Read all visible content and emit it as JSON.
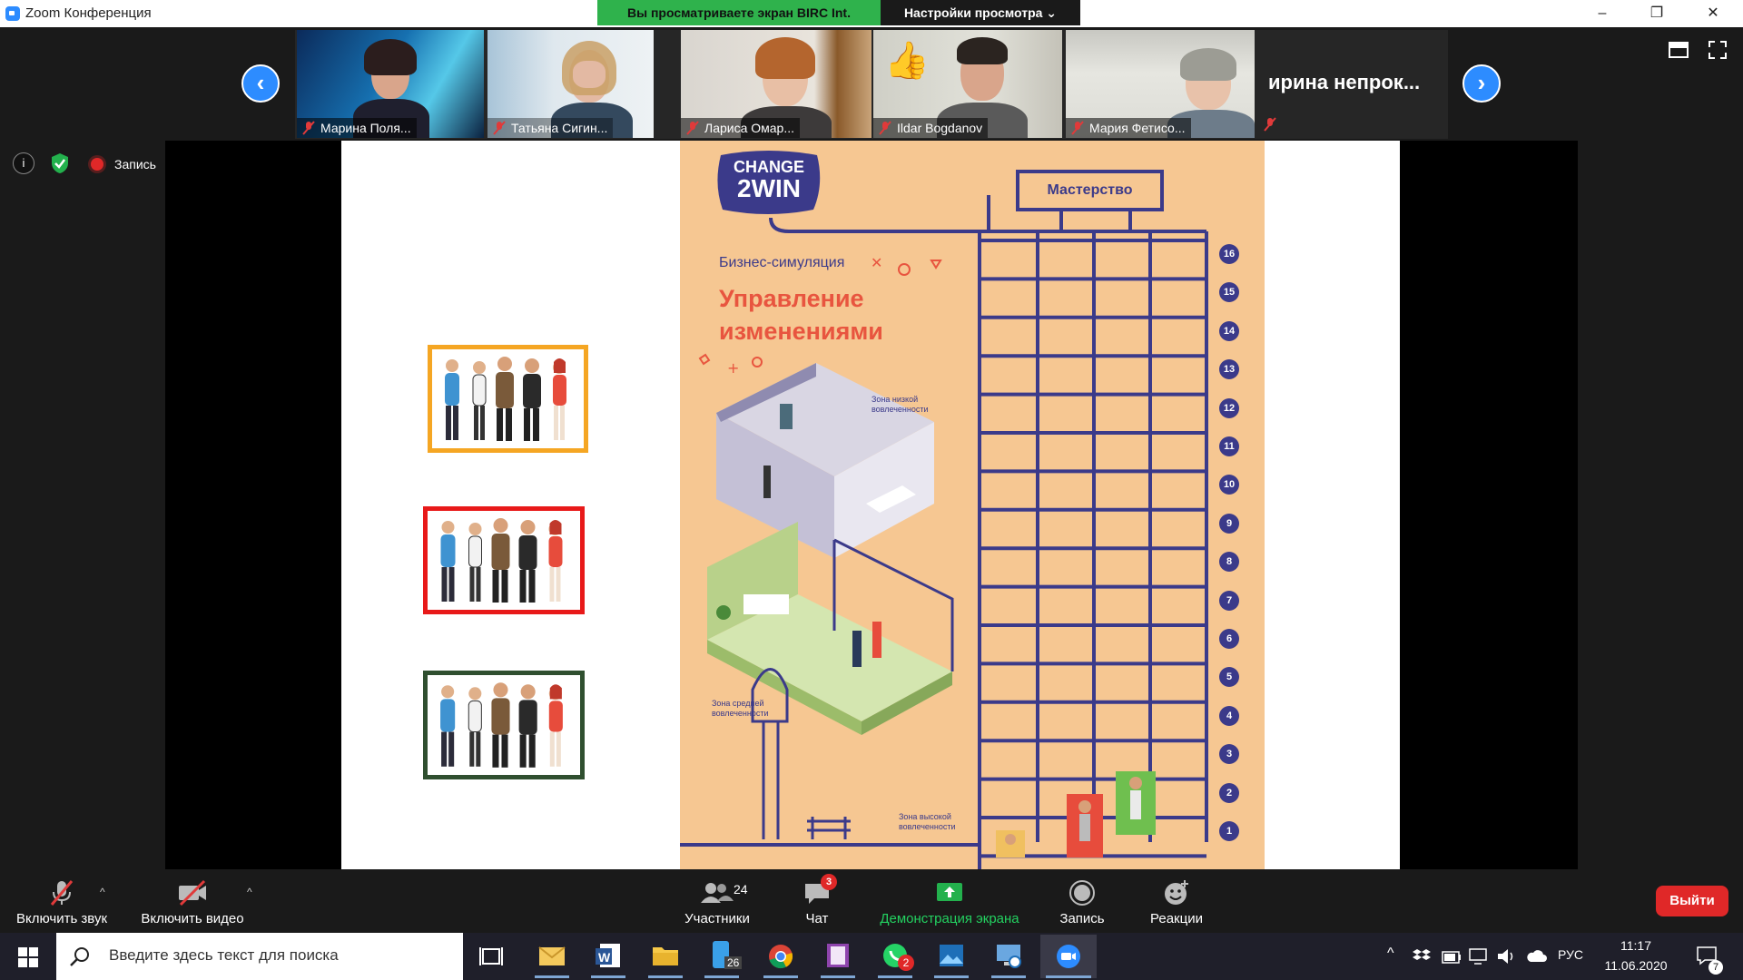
{
  "window": {
    "title": "Zoom Конференция",
    "minimize": "–",
    "restore": "❐",
    "close": "✕"
  },
  "share_banner": {
    "text": "Вы просматриваете экран BIRC Int.",
    "view_options": "Настройки просмотра ⌄"
  },
  "participants": [
    {
      "name": "Марина Поля..."
    },
    {
      "name": "Татьяна Сигин..."
    },
    {
      "name": "Лариса Омар..."
    },
    {
      "name": "Ildar Bogdanov"
    },
    {
      "name": "Мария Фетисо..."
    },
    {
      "name": "ирина  непрок..."
    }
  ],
  "meeting_info": {
    "recording_label": "Запись"
  },
  "slide": {
    "brand_line1": "CHANGE",
    "brand_line2": "2WIN",
    "mastery": "Мастерство",
    "subtitle": "Бизнес-симуляция",
    "title_line1": "Управление",
    "title_line2": "изменениями",
    "zone_low": "Зона низкой вовлеченности",
    "zone_mid": "Зона средней вовлеченности",
    "zone_high": "Зона высокой вовлеченности",
    "levels": [
      "16",
      "15",
      "14",
      "13",
      "12",
      "11",
      "10",
      "9",
      "8",
      "7",
      "6",
      "5",
      "4",
      "3",
      "2",
      "1"
    ],
    "frame_colors": [
      "#f5a623",
      "#e81919",
      "#2f4f2f"
    ]
  },
  "toolbar": {
    "unmute": "Включить звук",
    "start_video": "Включить видео",
    "participants": "Участники",
    "participants_count": "24",
    "chat": "Чат",
    "chat_badge": "3",
    "share_screen": "Демонстрация экрана",
    "record": "Запись",
    "reactions": "Реакции",
    "leave": "Выйти"
  },
  "taskbar": {
    "search_placeholder": "Введите здесь текст для поиска",
    "files_badge": "26",
    "whatsapp_badge": "2",
    "language": "РУС",
    "time": "11:17",
    "date": "11.06.2020",
    "notif_count": "7"
  }
}
